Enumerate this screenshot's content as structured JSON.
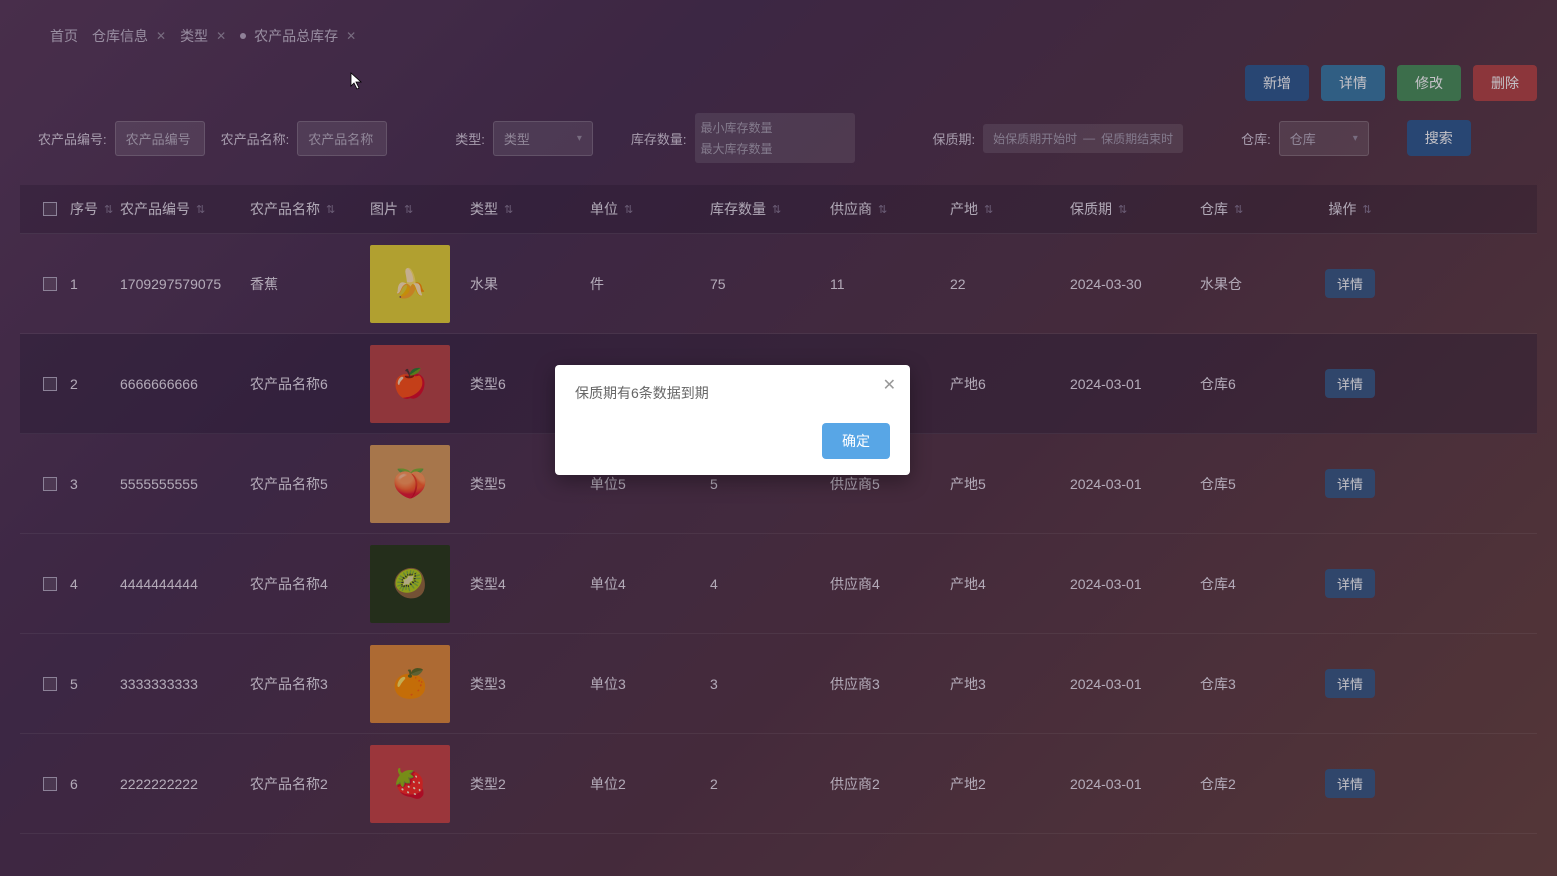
{
  "tabs": [
    {
      "label": "首页",
      "closable": false
    },
    {
      "label": "仓库信息",
      "closable": true
    },
    {
      "label": "类型",
      "closable": true
    },
    {
      "label": "农产品总库存",
      "closable": true,
      "active": true
    }
  ],
  "toolbar": {
    "add": "新增",
    "detail": "详情",
    "modify": "修改",
    "delete": "删除",
    "search": "搜索"
  },
  "filters": {
    "prod_id_label": "农产品编号:",
    "prod_id_placeholder": "农产品编号",
    "prod_name_label": "农产品名称:",
    "prod_name_placeholder": "农产品名称",
    "type_label": "类型:",
    "type_placeholder": "类型",
    "stock_label": "库存数量:",
    "stock_min_placeholder": "最小库存数量",
    "stock_max_placeholder": "最大库存数量",
    "expire_label": "保质期:",
    "expire_from_placeholder": "始保质期开始时",
    "expire_to_placeholder": "保质期结束时",
    "warehouse_label": "仓库:",
    "warehouse_placeholder": "仓库"
  },
  "columns": {
    "seq": "序号",
    "prod_id": "农产品编号",
    "prod_name": "农产品名称",
    "image": "图片",
    "type": "类型",
    "unit": "单位",
    "stock": "库存数量",
    "supplier": "供应商",
    "origin": "产地",
    "expire": "保质期",
    "warehouse": "仓库",
    "action": "操作"
  },
  "row_action_label": "详情",
  "rows": [
    {
      "seq": "1",
      "prod_id": "1709297579075",
      "prod_name": "香蕉",
      "thumb_bg": "#e6d236",
      "thumb_emoji": "🍌",
      "type": "水果",
      "unit": "件",
      "stock": "75",
      "supplier": "11",
      "origin": "22",
      "expire": "2024-03-30",
      "warehouse": "水果仓"
    },
    {
      "seq": "2",
      "prod_id": "6666666666",
      "prod_name": "农产品名称6",
      "thumb_bg": "#b84545",
      "thumb_emoji": "🍎",
      "type": "类型6",
      "unit": "",
      "stock": "",
      "supplier": "",
      "origin": "产地6",
      "expire": "2024-03-01",
      "warehouse": "仓库6",
      "selected": true
    },
    {
      "seq": "3",
      "prod_id": "5555555555",
      "prod_name": "农产品名称5",
      "thumb_bg": "#d89a5a",
      "thumb_emoji": "🍑",
      "type": "类型5",
      "unit": "单位5",
      "stock": "5",
      "supplier": "供应商5",
      "origin": "产地5",
      "expire": "2024-03-01",
      "warehouse": "仓库5"
    },
    {
      "seq": "4",
      "prod_id": "4444444444",
      "prod_name": "农产品名称4",
      "thumb_bg": "#2a3a1a",
      "thumb_emoji": "🥝",
      "type": "类型4",
      "unit": "单位4",
      "stock": "4",
      "supplier": "供应商4",
      "origin": "产地4",
      "expire": "2024-03-01",
      "warehouse": "仓库4"
    },
    {
      "seq": "5",
      "prod_id": "3333333333",
      "prod_name": "农产品名称3",
      "thumb_bg": "#e08a3a",
      "thumb_emoji": "🍊",
      "type": "类型3",
      "unit": "单位3",
      "stock": "3",
      "supplier": "供应商3",
      "origin": "产地3",
      "expire": "2024-03-01",
      "warehouse": "仓库3"
    },
    {
      "seq": "6",
      "prod_id": "2222222222",
      "prod_name": "农产品名称2",
      "thumb_bg": "#c84545",
      "thumb_emoji": "🍓",
      "type": "类型2",
      "unit": "单位2",
      "stock": "2",
      "supplier": "供应商2",
      "origin": "产地2",
      "expire": "2024-03-01",
      "warehouse": "仓库2"
    }
  ],
  "modal": {
    "message": "保质期有6条数据到期",
    "confirm": "确定"
  }
}
